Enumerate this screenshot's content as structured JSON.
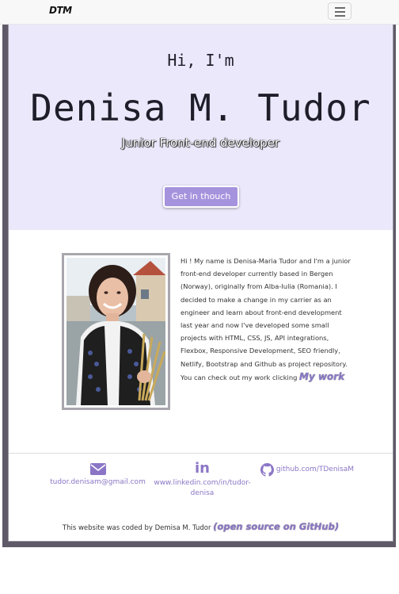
{
  "navbar": {
    "logo": "DTM",
    "toggle_icon": "hamburger-icon"
  },
  "hero": {
    "greeting": "Hi, I'm",
    "name": "Denisa M. Tudor",
    "role": "Junior Front-end developer",
    "cta_label": "Get in thouch",
    "background": "#ece8fb",
    "accent": "#a693dd"
  },
  "about": {
    "photo_alt": "Denisa M. Tudor",
    "text": "Hi ! My name is Denisa-Maria Tudor and I'm a junior front-end developer currently based in Bergen (Norway), originally from Alba-Iulia (Romania). I decided to make a change in my carrier as an engineer and learn about front-end development last year and now I've developed some small projects with HTML, CSS, JS, API integrations, Flexbox, Responsive Development, SEO friendly, Netlify, Bootstrap and Github as project repository. You can check out my work clicking",
    "link_label": "My work"
  },
  "contacts": {
    "email": "tudor.denisam@gmail.com",
    "email_icon": "envelope-icon",
    "linkedin": "www.linkedin.com/in/tudor-denisa",
    "linkedin_icon": "linkedin-icon",
    "github": "github.com/TDenisaM",
    "github_icon": "github-icon"
  },
  "footer": {
    "text": "This website was coded by Demisa M. Tudor",
    "link_label": "(open source on GitHub)"
  }
}
